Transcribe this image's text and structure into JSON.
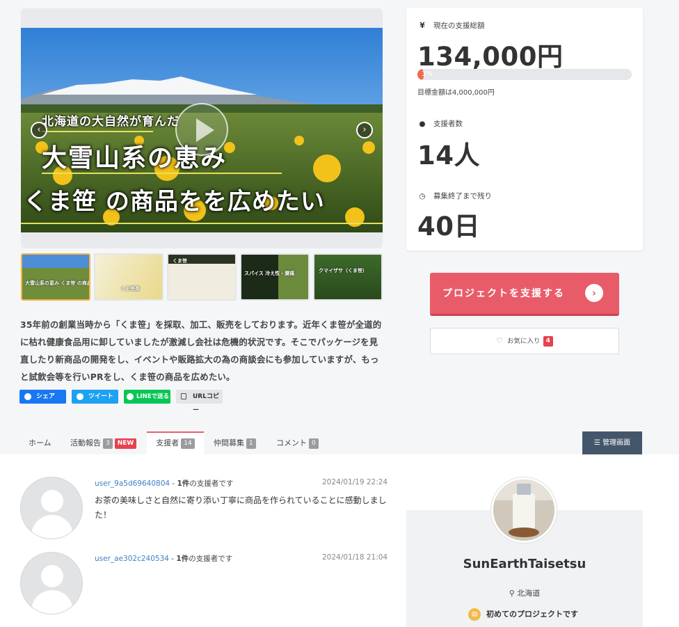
{
  "hero": {
    "line1": "北海道の大自然が育んだ",
    "line2": "大雪山系の恵み",
    "line3": "くま笹 の商品をを広めたい",
    "prev_icon": "chevron-left-icon",
    "next_icon": "chevron-right-icon"
  },
  "thumbnails": [
    {
      "caption": "大雪山系の恵み くま笹 の商品を広めたい"
    },
    {
      "caption": "くま笹茶"
    },
    {
      "caption": "くま笹"
    },
    {
      "caption": "スパイス 冷え性・腰痛"
    },
    {
      "caption": "クマイザサ（くま笹）"
    }
  ],
  "description": "35年前の創業当時から「くま笹」を採取、加工、販売をしております。近年くま笹が全道的に枯れ健康食品用に卸していましたが激減し会社は危機的状況です。そこでパッケージを見直したり新商品の開発をし、イベントや販路拡大の為の商談会にも参加していますが、もっと試飲会等を行いPRをし、くま笹の商品を広めたい。",
  "share": {
    "facebook": "シェア",
    "twitter": "ツイート",
    "line": "LINEで送る",
    "url": "URLコピー"
  },
  "stats": {
    "total_label": "現在の支援総額",
    "total_value": "134,000円",
    "progress_text": "3%",
    "progress_percent": 3,
    "goal_text": "目標金額は4,000,000円",
    "backers_label": "支援者数",
    "backers_value": "14人",
    "remaining_label": "募集終了まで残り",
    "remaining_value": "40日"
  },
  "actions": {
    "support_label": "プロジェクトを支援する",
    "favorite_label": "お気に入り",
    "favorite_count": "4"
  },
  "tabs": [
    {
      "label": "ホーム"
    },
    {
      "label": "活動報告",
      "count": "3",
      "badge": "NEW"
    },
    {
      "label": "支援者",
      "count": "14"
    },
    {
      "label": "仲間募集",
      "count": "1"
    },
    {
      "label": "コメント",
      "count": "0"
    }
  ],
  "admin_label": "管理画面",
  "backers": [
    {
      "user": "user_9a5d69640804",
      "separator": " - ",
      "count_text": "1件",
      "suffix": "の支援者です",
      "date": "2024/01/19 22:24",
      "comment": "お茶の美味しさと自然に寄り添い丁寧に商品を作られていることに感動しました！"
    },
    {
      "user": "user_ae302c240534",
      "separator": " - ",
      "count_text": "1件",
      "suffix": "の支援者です",
      "date": "2024/01/18 21:04",
      "comment": ""
    }
  ],
  "owner": {
    "name": "SunEarthTaisetsu",
    "location": "北海道",
    "first_project": "初めてのプロジェクトです"
  },
  "colors": {
    "accent": "#e85c6a",
    "progress": "#f06a4c",
    "link": "#3b82c4",
    "admin": "#44566b"
  }
}
